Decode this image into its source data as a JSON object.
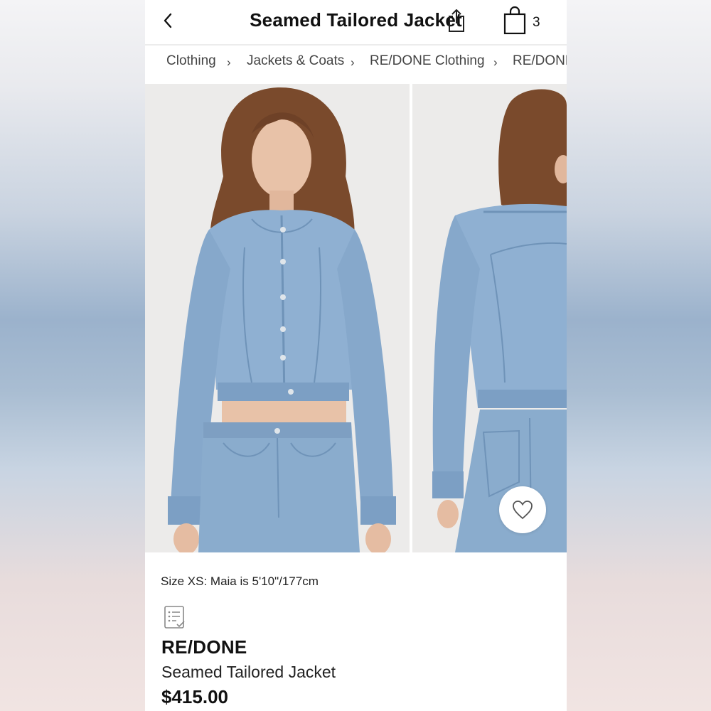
{
  "header": {
    "title": "Seamed Tailored Jacket",
    "back_icon": "chevron-left-icon",
    "share_icon": "share-icon",
    "bag_icon": "shopping-bag-icon",
    "bag_count": "3"
  },
  "breadcrumb": {
    "items": [
      "Clothing",
      "Jackets & Coats",
      "RE/DONE Clothing",
      "RE/DONE"
    ],
    "separator": "›"
  },
  "gallery": {
    "images": [
      "model-front-photo",
      "model-back-photo"
    ],
    "wishlist_icon": "heart-icon"
  },
  "product": {
    "size_note": "Size XS: Maia is 5'10\"/177cm",
    "details_icon": "list-details-icon",
    "brand": "RE/DONE",
    "name": "Seamed Tailored Jacket",
    "price": "$415.00"
  },
  "colors": {
    "denim": "#8fb0d2",
    "denim_dark": "#6f93b8",
    "hair": "#7a4a2c",
    "skin": "#e8c2a8",
    "photo_bg": "#ecebea"
  }
}
